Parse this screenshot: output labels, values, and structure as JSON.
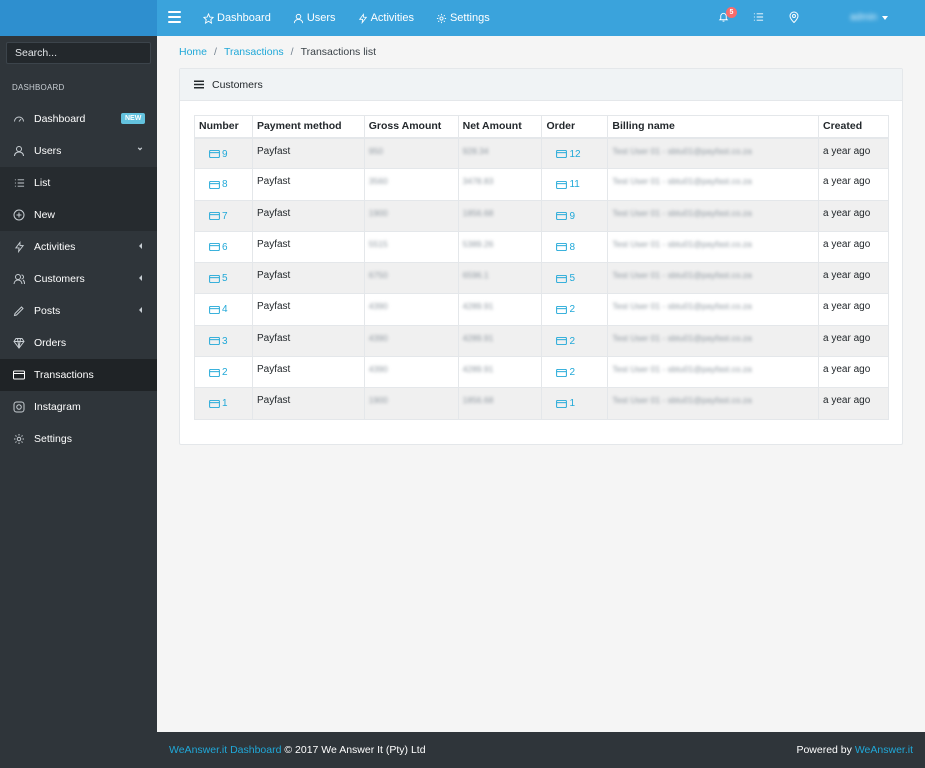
{
  "header": {
    "nav": [
      {
        "label": "Dashboard",
        "icon": "star-icon"
      },
      {
        "label": "Users",
        "icon": "users-icon"
      },
      {
        "label": "Activities",
        "icon": "lightning-icon"
      },
      {
        "label": "Settings",
        "icon": "gear-icon"
      }
    ],
    "notification_count": "5",
    "user_label": "admin"
  },
  "sidebar": {
    "search_placeholder": "Search...",
    "section_title": "DASHBOARD",
    "items": [
      {
        "label": "Dashboard",
        "badge": "NEW"
      },
      {
        "label": "Users"
      },
      {
        "label": "List"
      },
      {
        "label": "New"
      },
      {
        "label": "Activities"
      },
      {
        "label": "Customers"
      },
      {
        "label": "Posts"
      },
      {
        "label": "Orders"
      },
      {
        "label": "Transactions"
      },
      {
        "label": "Instagram"
      },
      {
        "label": "Settings"
      }
    ]
  },
  "breadcrumb": {
    "home": "Home",
    "section": "Transactions",
    "current": "Transactions list"
  },
  "card": {
    "title": "Customers"
  },
  "table": {
    "columns": [
      "Number",
      "Payment method",
      "Gross Amount",
      "Net Amount",
      "Order",
      "Billing name",
      "Created"
    ],
    "rows": [
      {
        "number": "9",
        "method": "Payfast",
        "gross": "950",
        "net": "928.34",
        "order": "12",
        "billing": "Test User 01 - sbtu01@payfast.co.za",
        "created": "a year ago"
      },
      {
        "number": "8",
        "method": "Payfast",
        "gross": "3560",
        "net": "3478.83",
        "order": "11",
        "billing": "Test User 01 - sbtu01@payfast.co.za",
        "created": "a year ago"
      },
      {
        "number": "7",
        "method": "Payfast",
        "gross": "1900",
        "net": "1856.68",
        "order": "9",
        "billing": "Test User 01 - sbtu01@payfast.co.za",
        "created": "a year ago"
      },
      {
        "number": "6",
        "method": "Payfast",
        "gross": "5515",
        "net": "5389.26",
        "order": "8",
        "billing": "Test User 01 - sbtu01@payfast.co.za",
        "created": "a year ago"
      },
      {
        "number": "5",
        "method": "Payfast",
        "gross": "6750",
        "net": "6596.1",
        "order": "5",
        "billing": "Test User 01 - sbtu01@payfast.co.za",
        "created": "a year ago"
      },
      {
        "number": "4",
        "method": "Payfast",
        "gross": "4390",
        "net": "4289.91",
        "order": "2",
        "billing": "Test User 01 - sbtu01@payfast.co.za",
        "created": "a year ago"
      },
      {
        "number": "3",
        "method": "Payfast",
        "gross": "4390",
        "net": "4289.91",
        "order": "2",
        "billing": "Test User 01 - sbtu01@payfast.co.za",
        "created": "a year ago"
      },
      {
        "number": "2",
        "method": "Payfast",
        "gross": "4390",
        "net": "4289.91",
        "order": "2",
        "billing": "Test User 01 - sbtu01@payfast.co.za",
        "created": "a year ago"
      },
      {
        "number": "1",
        "method": "Payfast",
        "gross": "1900",
        "net": "1856.68",
        "order": "1",
        "billing": "Test User 01 - sbtu01@payfast.co.za",
        "created": "a year ago"
      }
    ]
  },
  "footer": {
    "brand_link": "WeAnswer.it Dashboard",
    "copyright": "© 2017 We Answer It (Pty) Ltd",
    "powered_by": "Powered by",
    "powered_link": "WeAnswer.it"
  },
  "colors": {
    "primary": "#3aa3dc",
    "sidebar": "#2f353a",
    "link": "#20a8d8",
    "badge": "#63c2de",
    "danger": "#f86c6b"
  }
}
